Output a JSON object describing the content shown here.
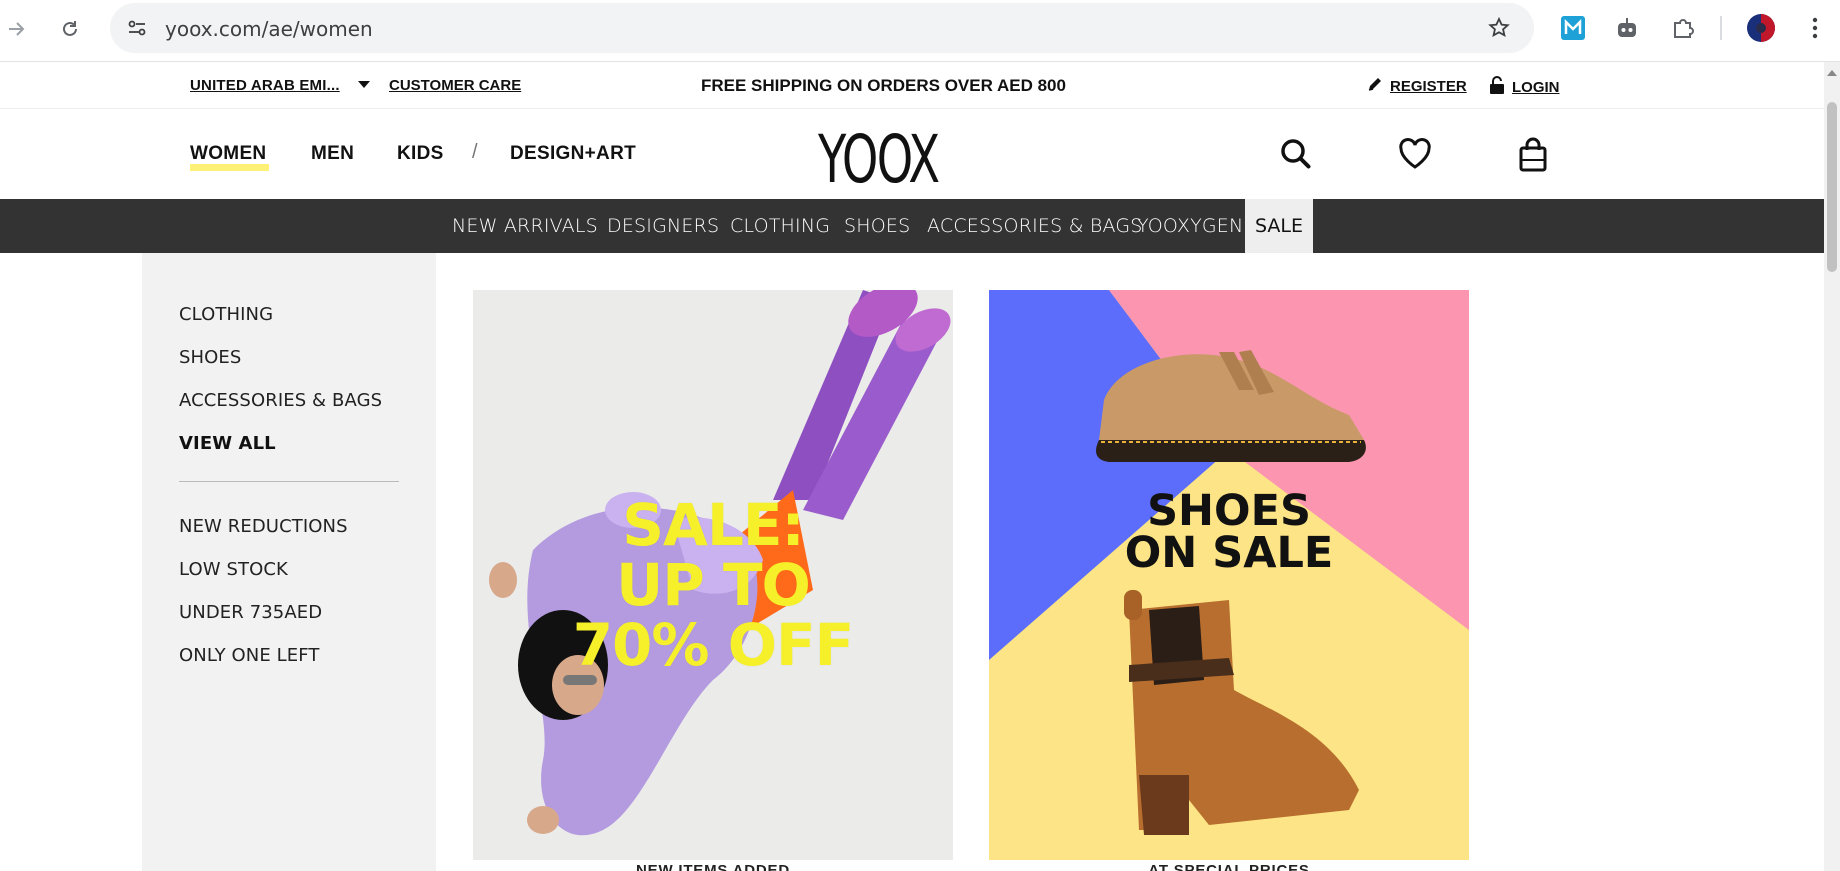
{
  "browser": {
    "url": "yoox.com/ae/women",
    "back_icon": "arrow-right-icon",
    "reload_icon": "reload-icon",
    "extensions": [
      "m-extension-icon",
      "robot-extension-icon",
      "puzzle-extension-icon",
      "profile-avatar"
    ]
  },
  "topbar": {
    "country": "UNITED ARAB EMI...",
    "customer_care": "CUSTOMER CARE",
    "promo": "FREE SHIPPING ON ORDERS OVER AED 800",
    "register": "REGISTER",
    "login": "LOGIN"
  },
  "header": {
    "nav": [
      "WOMEN",
      "MEN",
      "KIDS",
      "DESIGN+ART"
    ],
    "separator": "/",
    "logo": "YOOX",
    "icons": [
      "search-icon",
      "heart-icon",
      "bag-icon"
    ]
  },
  "categories": {
    "items": [
      "NEW ARRIVALS",
      "DESIGNERS",
      "CLOTHING",
      "SHOES",
      "ACCESSORIES & BAGS",
      "YOOXYGEN"
    ],
    "active": "SALE"
  },
  "sidebar": {
    "primary": [
      "CLOTHING",
      "SHOES",
      "ACCESSORIES & BAGS"
    ],
    "view_all": "VIEW ALL",
    "secondary": [
      "NEW REDUCTIONS",
      "LOW STOCK",
      "UNDER 735AED",
      "ONLY ONE LEFT"
    ]
  },
  "banners": {
    "left": {
      "headline": [
        "SALE:",
        "UP TO",
        "70% OFF"
      ],
      "caption": "NEW ITEMS ADDED"
    },
    "right": {
      "headline": [
        "SHOES",
        "ON SALE"
      ],
      "caption": "AT SPECIAL PRICES"
    }
  },
  "colors": {
    "category_bar": "#333333",
    "women_highlight": "#fff176",
    "sale_yellow": "#f6f02a",
    "shoes_blue": "#5b6dfa",
    "shoes_pink": "#fb95b0",
    "shoes_yellow": "#fde486"
  }
}
